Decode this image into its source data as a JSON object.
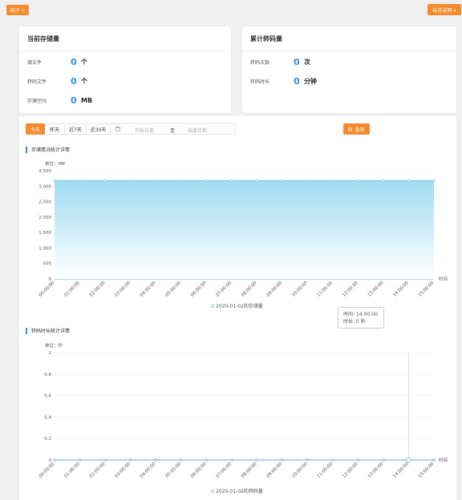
{
  "topbar": {
    "stats_label": "统计 ×",
    "billing_label": "标签说明 ▾"
  },
  "storage_card": {
    "title": "当前存储量",
    "rows": [
      {
        "label": "源文件",
        "value": "0",
        "unit": "个"
      },
      {
        "label": "转码文件",
        "value": "0",
        "unit": "个"
      },
      {
        "label": "存储空间",
        "value": "0",
        "unit": "MB"
      }
    ]
  },
  "transcode_card": {
    "title": "累计转码量",
    "rows": [
      {
        "label": "转码次数",
        "value": "0",
        "unit": "次"
      },
      {
        "label": "转码时长",
        "value": "0",
        "unit": "分钟"
      }
    ]
  },
  "filters": {
    "quick": [
      "今天",
      "昨天",
      "近7天",
      "近30天"
    ],
    "active_index": 0,
    "start_placeholder": "开始日期",
    "separator": "至",
    "end_placeholder": "结束日期",
    "query_label": "查询"
  },
  "colors": {
    "accent": "#f68a2e",
    "blue": "#2f8fe6",
    "area": "#9fdcf2"
  },
  "chart_data": [
    {
      "type": "area",
      "title": "存储情况统计详情",
      "unit_label": "单位：MB",
      "xlabel": "时间",
      "x": [
        "00:00:00",
        "01:00:00",
        "02:00:00",
        "03:00:00",
        "04:00:00",
        "05:00:00",
        "06:00:00",
        "07:00:00",
        "08:00:00",
        "09:00:00",
        "10:00:00",
        "11:00:00",
        "12:00:00",
        "13:00:00",
        "14:00:00",
        "15:00:00"
      ],
      "series": [
        {
          "name": "2020-01-02的存储量",
          "values": [
            3180,
            3180,
            3180,
            3180,
            3180,
            3180,
            3180,
            3180,
            3180,
            3180,
            3180,
            3180,
            3180,
            3180,
            3180,
            3180
          ]
        }
      ],
      "yticks": [
        "3,500",
        "3,000",
        "2,500",
        "2,000",
        "1,500",
        "1,000",
        "500",
        "0"
      ],
      "ylim": [
        0,
        3500
      ],
      "grid": true,
      "legend": "bottom"
    },
    {
      "type": "line",
      "title": "转码时长统计详情",
      "unit_label": "单位：秒",
      "xlabel": "时间",
      "x": [
        "00:00:00",
        "01:00:00",
        "02:00:00",
        "03:00:00",
        "04:00:00",
        "05:00:00",
        "06:00:00",
        "07:00:00",
        "08:00:00",
        "09:00:00",
        "10:00:00",
        "11:00:00",
        "12:00:00",
        "13:00:00",
        "14:00:00",
        "15:00:00"
      ],
      "series": [
        {
          "name": "2020-01-02的转码量",
          "values": [
            0,
            0,
            0,
            0,
            0,
            0,
            0,
            0,
            0,
            0,
            0,
            0,
            0,
            0,
            0,
            0
          ]
        }
      ],
      "yticks": [
        "1",
        "0.8",
        "0.6",
        "0.4",
        "0.2",
        "0"
      ],
      "ylim": [
        0,
        1
      ],
      "grid": true,
      "legend": "bottom",
      "tooltip": {
        "time": "时间: 14:00:00",
        "duration": "时长: 0 秒"
      }
    }
  ]
}
